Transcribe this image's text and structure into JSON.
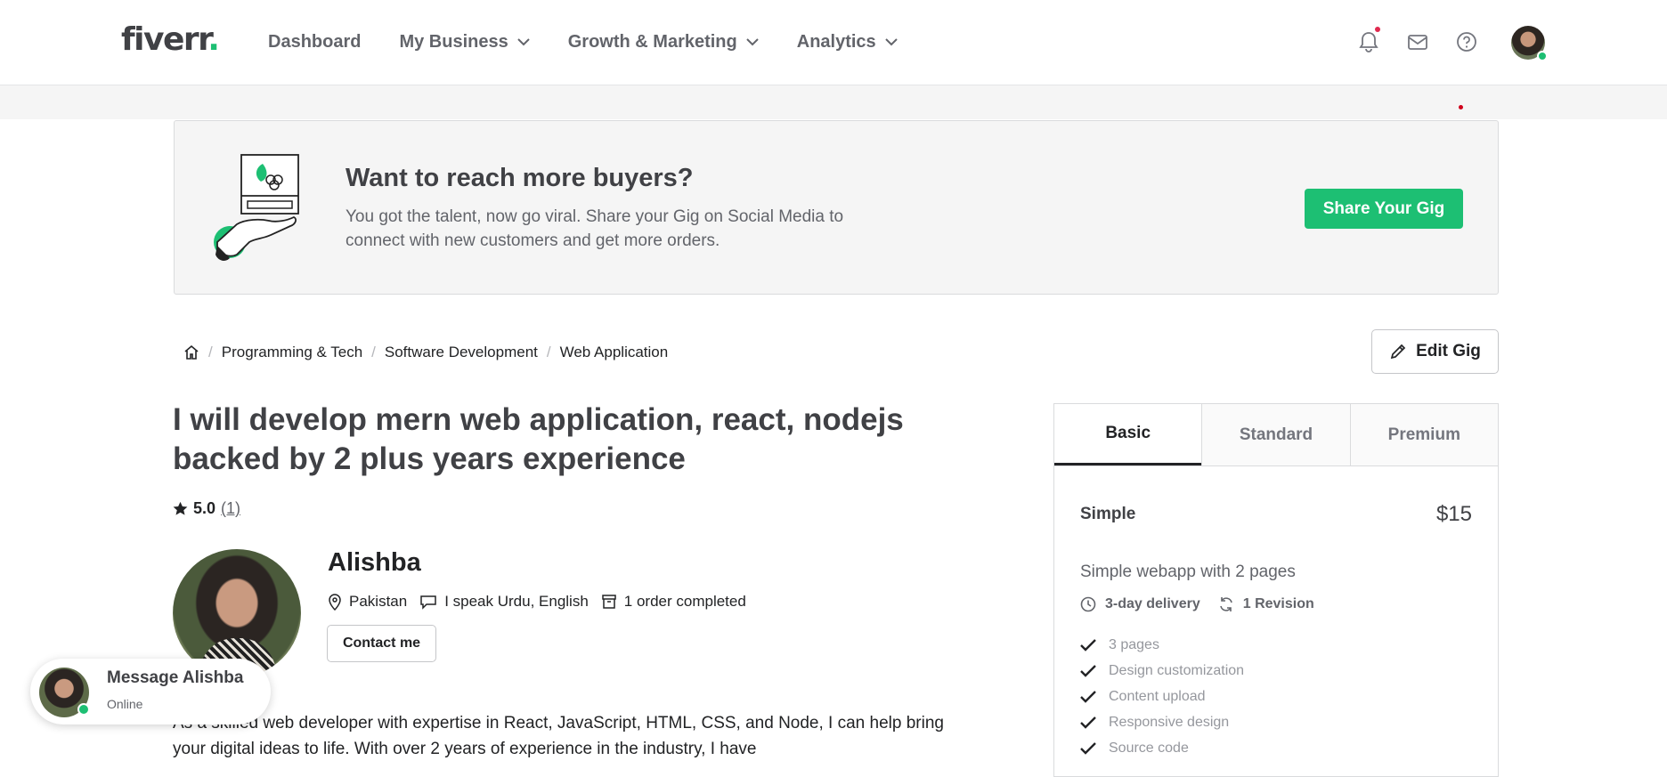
{
  "header": {
    "logo": "fiverr",
    "logo_dot": ".",
    "nav": [
      {
        "label": "Dashboard"
      },
      {
        "label": "My Business"
      },
      {
        "label": "Growth & Marketing"
      },
      {
        "label": "Analytics"
      }
    ]
  },
  "banner": {
    "title": "Want to reach more buyers?",
    "text": "You got the talent, now go viral. Share your Gig on Social Media to connect with new customers and get more orders.",
    "button": "Share Your Gig"
  },
  "breadcrumb": [
    "Programming & Tech",
    "Software Development",
    "Web Application"
  ],
  "edit_button": "Edit Gig",
  "gig": {
    "title": "I will develop mern web application, react, nodejs backed by 2 plus years experience",
    "rating": "5.0",
    "reviews": "(1)",
    "description": "As a skilled web developer with expertise in React, JavaScript, HTML, CSS, and Node, I can help bring your digital ideas to life. With over 2 years of experience in the industry, I have"
  },
  "seller": {
    "name": "Alishba",
    "country": "Pakistan",
    "languages": "I speak Urdu, English",
    "orders": "1 order completed",
    "contact_button": "Contact me"
  },
  "message_popup": {
    "title": "Message Alishba",
    "status": "Online"
  },
  "package": {
    "tabs": [
      "Basic",
      "Standard",
      "Premium"
    ],
    "active_tab": "Basic",
    "name": "Simple",
    "price": "$15",
    "description": "Simple webapp with 2 pages",
    "delivery": "3-day delivery",
    "revisions": "1 Revision",
    "features": [
      "3 pages",
      "Design customization",
      "Content upload",
      "Responsive design",
      "Source code"
    ]
  },
  "colors": {
    "brand_green": "#1dbf73",
    "text_dark": "#404145",
    "notification_dot": "#e0294f"
  }
}
